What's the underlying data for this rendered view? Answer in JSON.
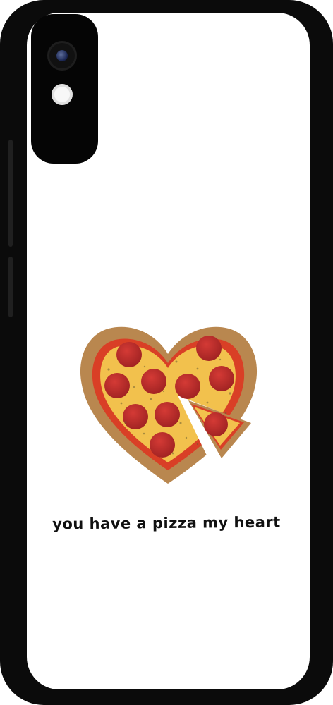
{
  "caption": "you have a pizza my heart",
  "colors": {
    "case": "#0b0b0b",
    "background": "#ffffff",
    "crust": "#b9874f",
    "sauce": "#d93f26",
    "cheese": "#f2c14d",
    "pepperoni": "#c7302c",
    "pepperoni_dark": "#8e1f1f",
    "text": "#101010"
  },
  "icons": {
    "camera": "camera-icon",
    "flash": "flash-icon",
    "pizza": "pizza-heart-icon"
  }
}
